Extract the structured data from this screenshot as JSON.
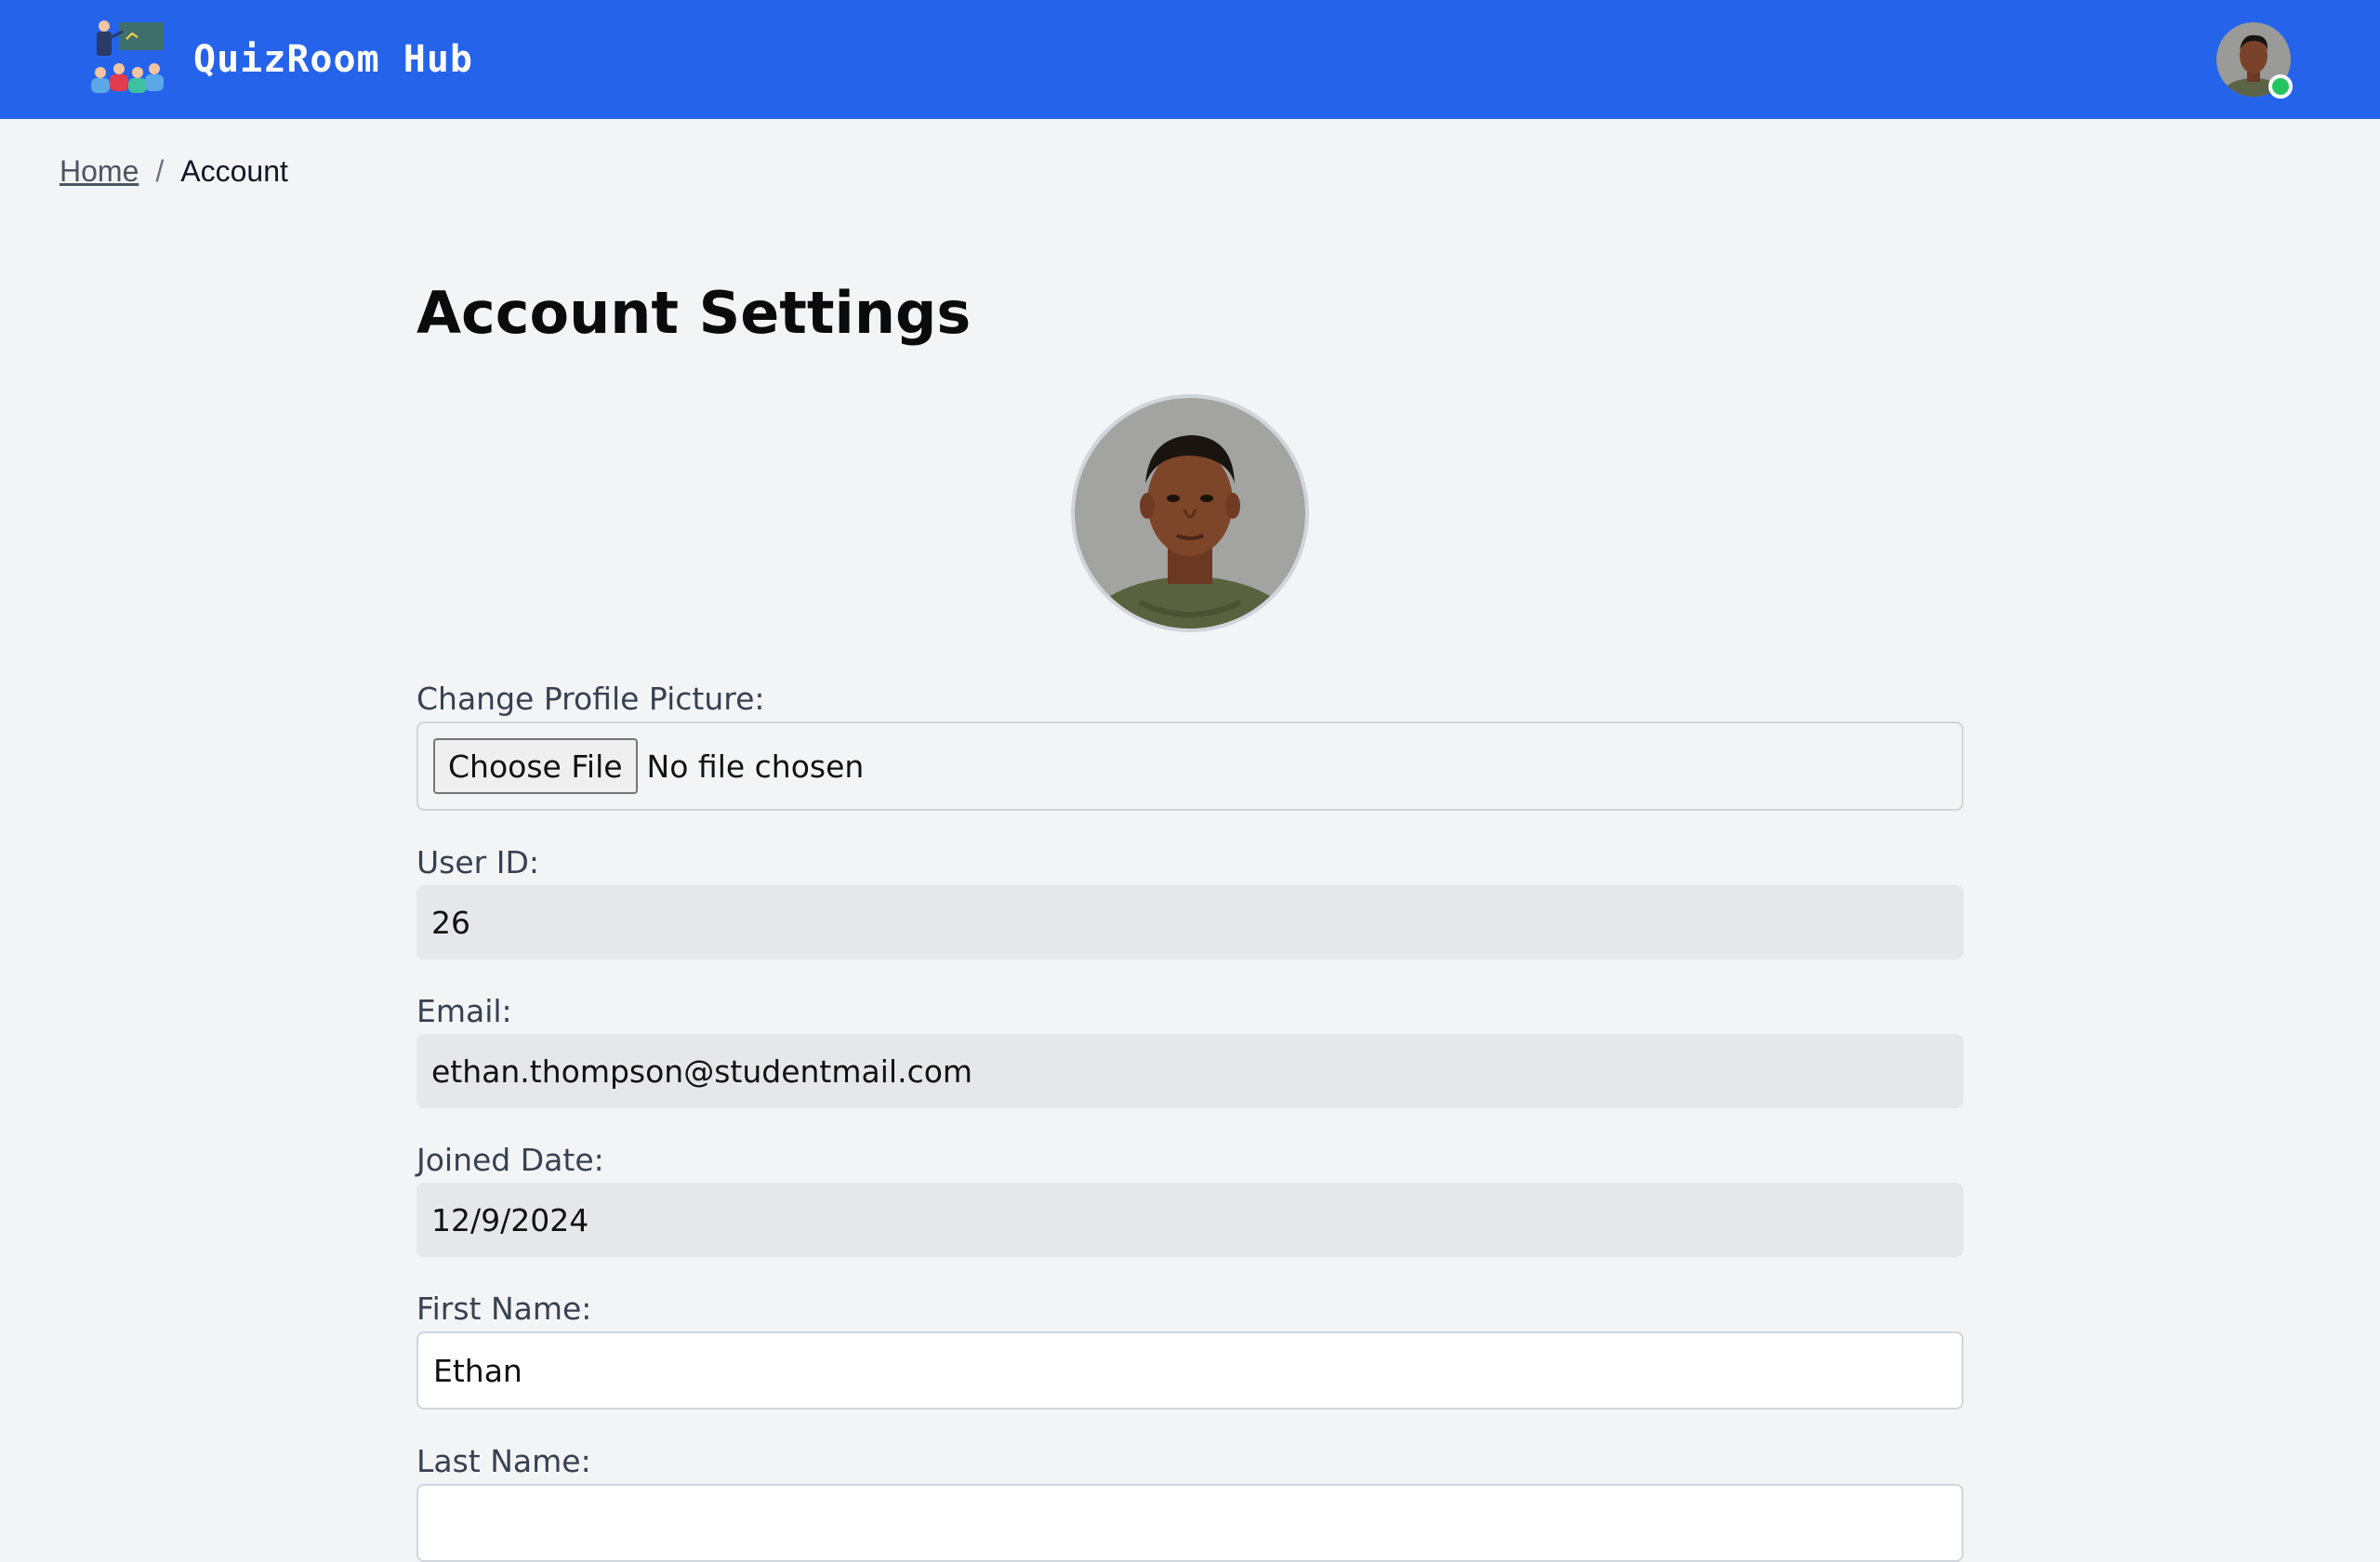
{
  "app": {
    "name": "QuizRoom Hub",
    "logo_icon": "classroom-teacher-icon",
    "accent_color": "#2563eb",
    "online_status_color": "#22c55e"
  },
  "breadcrumb": {
    "home": "Home",
    "separator": "/",
    "current": "Account"
  },
  "page": {
    "title": "Account Settings"
  },
  "form": {
    "profile_picture": {
      "label": "Change Profile Picture:",
      "button": "Choose File",
      "status": "No file chosen"
    },
    "user_id": {
      "label": "User ID:",
      "value": "26"
    },
    "email": {
      "label": "Email:",
      "value": "ethan.thompson@studentmail.com"
    },
    "joined_date": {
      "label": "Joined Date:",
      "value": "12/9/2024"
    },
    "first_name": {
      "label": "First Name:",
      "value": "Ethan"
    },
    "last_name": {
      "label": "Last Name:"
    }
  }
}
